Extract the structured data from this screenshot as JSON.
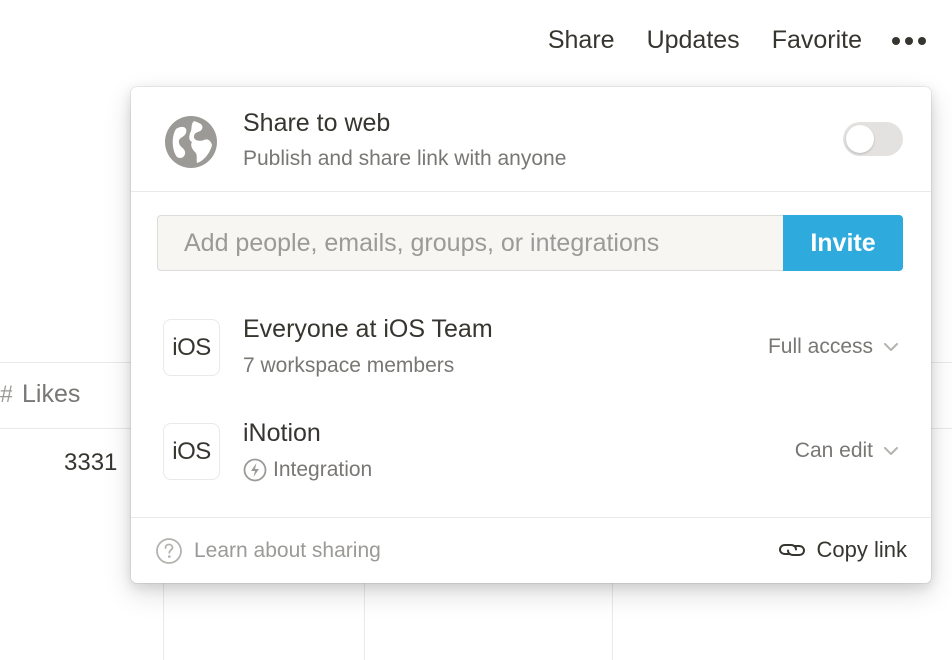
{
  "topbar": {
    "share_label": "Share",
    "updates_label": "Updates",
    "favorite_label": "Favorite",
    "more_icon": "more-horizontal-icon"
  },
  "background": {
    "likes_header": "Likes",
    "likes_value": "3331"
  },
  "share_popup": {
    "share_to_web": {
      "title": "Share to web",
      "subtitle": "Publish and share link with anyone",
      "icon": "globe-icon",
      "toggle_on": false
    },
    "invite": {
      "placeholder": "Add people, emails, groups, or integrations",
      "value": "",
      "button_label": "Invite",
      "button_color": "#2eaadc"
    },
    "members": [
      {
        "avatar_text": "iOS",
        "name": "Everyone at iOS Team",
        "subtitle": "7 workspace members",
        "access": "Full access"
      },
      {
        "avatar_text": "iOS",
        "name": "iNotion",
        "subtitle": "Integration",
        "access": "Can edit"
      }
    ],
    "footer": {
      "learn_label": "Learn about sharing",
      "copy_link_label": "Copy link"
    }
  }
}
